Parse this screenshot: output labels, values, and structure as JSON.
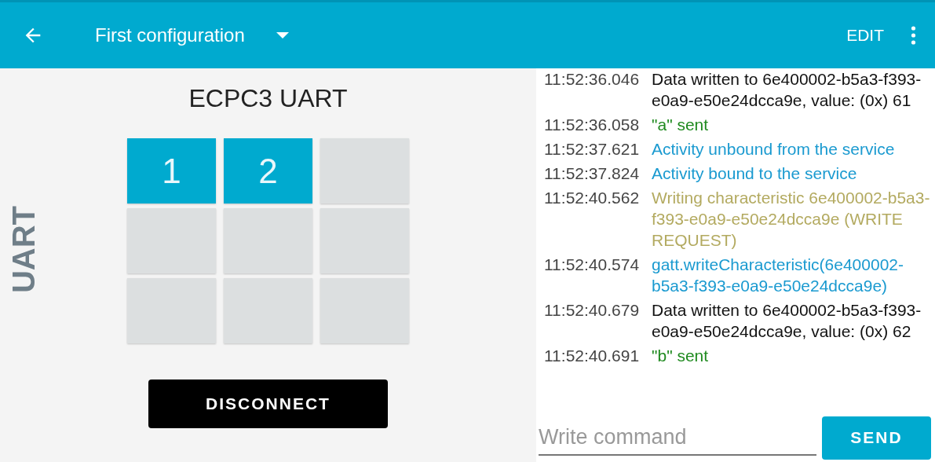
{
  "app_bar": {
    "title": "First configuration",
    "action": "EDIT"
  },
  "left_panel": {
    "side_label": "UART",
    "device_name": "ECPC3 UART",
    "keys": [
      {
        "label": "1",
        "active": true
      },
      {
        "label": "2",
        "active": true
      },
      {
        "active": false
      },
      {
        "active": false
      },
      {
        "active": false
      },
      {
        "active": false
      },
      {
        "active": false
      },
      {
        "active": false
      },
      {
        "active": false
      }
    ],
    "disconnect_button": "DISCONNECT"
  },
  "log": [
    {
      "time": "11:52:36.046",
      "kind": "data",
      "message": "Data written to 6e400002-b5a3-f393-e0a9-e50e24dcca9e, value: (0x) 61"
    },
    {
      "time": "11:52:36.058",
      "kind": "sent",
      "message": "\"a\" sent"
    },
    {
      "time": "11:52:37.621",
      "kind": "info",
      "message": "Activity unbound from the service"
    },
    {
      "time": "11:52:37.824",
      "kind": "info",
      "message": "Activity bound to the service"
    },
    {
      "time": "11:52:40.562",
      "kind": "warn",
      "message": "Writing characteristic 6e400002-b5a3-f393-e0a9-e50e24dcca9e (WRITE REQUEST)"
    },
    {
      "time": "11:52:40.574",
      "kind": "info",
      "message": "gatt.writeCharacteristic(6e400002-b5a3-f393-e0a9-e50e24dcca9e)"
    },
    {
      "time": "11:52:40.679",
      "kind": "data",
      "message": "Data written to 6e400002-b5a3-f393-e0a9-e50e24dcca9e, value: (0x) 62"
    },
    {
      "time": "11:52:40.691",
      "kind": "sent",
      "message": "\"b\" sent"
    }
  ],
  "command": {
    "placeholder": "Write command",
    "send_button": "SEND"
  }
}
